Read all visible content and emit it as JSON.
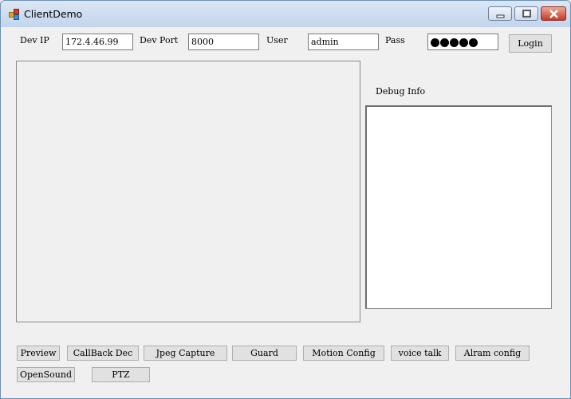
{
  "window": {
    "title": "ClientDemo",
    "icon": "app-window-icon",
    "controls": [
      "minimize-icon",
      "maximize-icon",
      "close-icon"
    ]
  },
  "login": {
    "ip_label": "Dev IP",
    "ip_value": "172.4.46.99",
    "port_label": "Dev Port",
    "port_value": "8000",
    "user_label": "User",
    "user_value": "admin",
    "pass_label": "Pass",
    "pass_length": 5,
    "login_label": "Login"
  },
  "debug": {
    "label": "Debug Info"
  },
  "buttons": {
    "preview": "Preview",
    "callback": "CallBack Dec",
    "jpeg": "Jpeg Capture",
    "guard": "Guard",
    "motion": "Motion Config",
    "voice": "voice talk",
    "alarm": "Alram config",
    "opensound": "OpenSound",
    "ptz": "PTZ"
  },
  "colors": {
    "titlebar": "#c9d9ee",
    "close": "#c63a25",
    "face": "#f0f0f0"
  }
}
